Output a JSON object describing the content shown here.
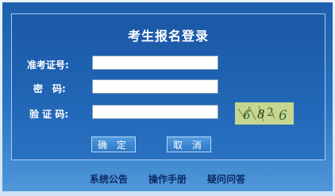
{
  "login": {
    "title": "考生报名登录",
    "fields": {
      "candidate_id_label": "准考证号:",
      "password_label": "密　码:",
      "captcha_label": "验 证 码:",
      "candidate_id_value": "",
      "password_value": "",
      "captcha_value": ""
    },
    "captcha_image_text": "6826",
    "buttons": {
      "confirm": "确 定",
      "cancel": "取 消"
    }
  },
  "footer_links": {
    "announcement": "系统公告",
    "manual": "操作手册",
    "faq": "疑问问答"
  },
  "colors": {
    "panel_blue": "#1f62b2",
    "border_light": "#a9cdee",
    "captcha_bg": "#c7d68f",
    "footer_text": "#0c2b66"
  }
}
